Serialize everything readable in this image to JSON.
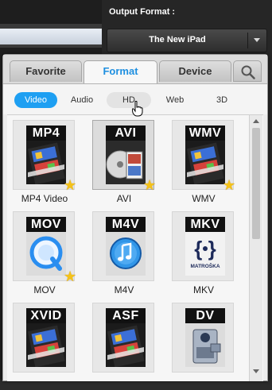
{
  "output": {
    "label": "Output Format :",
    "selected": "The New iPad"
  },
  "tabs": [
    {
      "label": "Favorite"
    },
    {
      "label": "Format"
    },
    {
      "label": "Device"
    }
  ],
  "subtabs": [
    {
      "label": "Video"
    },
    {
      "label": "Audio"
    },
    {
      "label": "HD"
    },
    {
      "label": "Web"
    },
    {
      "label": "3D"
    }
  ],
  "formats": [
    {
      "badge": "MP4",
      "label": "MP4 Video",
      "icon": "film-strip-icon",
      "favorite": true
    },
    {
      "badge": "AVI",
      "label": "AVI",
      "icon": "disc-film-icon",
      "favorite": true
    },
    {
      "badge": "WMV",
      "label": "WMV",
      "icon": "film-strip-icon",
      "favorite": true
    },
    {
      "badge": "MOV",
      "label": "MOV",
      "icon": "quicktime-icon",
      "favorite": true
    },
    {
      "badge": "M4V",
      "label": "M4V",
      "icon": "itunes-icon",
      "favorite": false
    },
    {
      "badge": "MKV",
      "label": "MKV",
      "icon": "matroska-icon",
      "favorite": false
    },
    {
      "badge": "XVID",
      "label": "",
      "icon": "film-strip-icon",
      "favorite": false
    },
    {
      "badge": "ASF",
      "label": "",
      "icon": "film-strip-icon",
      "favorite": false
    },
    {
      "badge": "DV",
      "label": "",
      "icon": "camcorder-icon",
      "favorite": false
    }
  ],
  "matroska_text": "MATROŠKA",
  "colors": {
    "accent": "#1e9ff2",
    "star": "#f4c219"
  }
}
